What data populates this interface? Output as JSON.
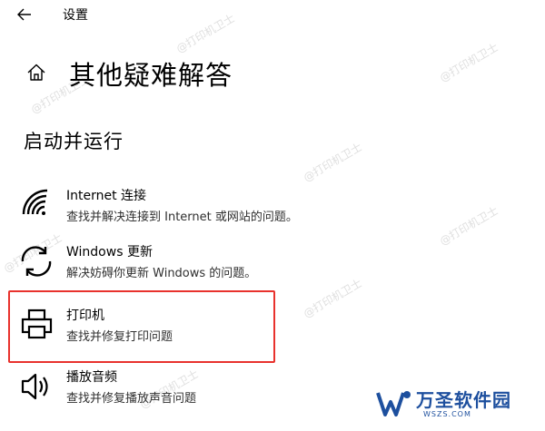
{
  "window": {
    "title": "设置"
  },
  "header": {
    "page_title": "其他疑难解答"
  },
  "section": {
    "title": "启动并运行"
  },
  "items": [
    {
      "name": "Internet 连接",
      "desc": "查找并解决连接到 Internet 或网站的问题。",
      "icon": "wifi-icon"
    },
    {
      "name": "Windows 更新",
      "desc": "解决妨碍你更新 Windows 的问题。",
      "icon": "refresh-icon"
    },
    {
      "name": "打印机",
      "desc": "查找并修复打印问题",
      "icon": "printer-icon"
    },
    {
      "name": "播放音频",
      "desc": "查找并修复播放声音问题",
      "icon": "speaker-icon"
    }
  ],
  "watermark": {
    "text": "@打印机卫士"
  },
  "logo": {
    "brand": "万圣软件园",
    "domain": "WSZS.COM"
  },
  "colors": {
    "highlight_border": "#e8322d",
    "logo_blue": "#1d4f9e"
  }
}
